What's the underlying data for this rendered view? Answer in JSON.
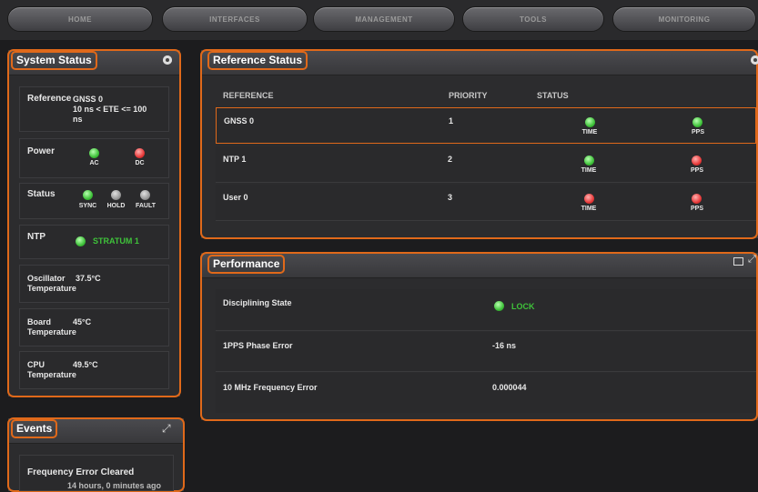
{
  "nav": [
    "HOME",
    "INTERFACES",
    "MANAGEMENT",
    "TOOLS",
    "MONITORING"
  ],
  "system_status": {
    "title": "System Status",
    "reference": {
      "label": "Reference",
      "value_line1": "GNSS 0",
      "value_line2": "10 ns < ETE <= 100",
      "value_line3": "ns"
    },
    "power": {
      "label": "Power",
      "ac": "AC",
      "dc": "DC"
    },
    "status": {
      "label": "Status",
      "sync": "SYNC",
      "hold": "HOLD",
      "fault": "FAULT"
    },
    "ntp": {
      "label": "NTP",
      "value": "STRATUM 1"
    },
    "oscillator": {
      "label_line1": "Oscillator",
      "label_line2": "Temperature",
      "value": "37.5°C"
    },
    "board": {
      "label_line1": "Board",
      "label_line2": "Temperature",
      "value": "45°C"
    },
    "cpu": {
      "label_line1": "CPU",
      "label_line2": "Temperature",
      "value": "49.5°C"
    }
  },
  "events": {
    "title": "Events",
    "item": "Frequency Error Cleared",
    "item_sub": "14 hours, 0 minutes ago"
  },
  "reference_status": {
    "title": "Reference Status",
    "headers": {
      "reference": "REFERENCE",
      "priority": "PRIORITY",
      "status": "STATUS"
    },
    "rows": [
      {
        "name": "GNSS 0",
        "priority": "1",
        "time": "TIME",
        "pps": "PPS",
        "time_color": "green",
        "pps_color": "green"
      },
      {
        "name": "NTP 1",
        "priority": "2",
        "time": "TIME",
        "pps": "PPS",
        "time_color": "green",
        "pps_color": "red"
      },
      {
        "name": "User 0",
        "priority": "3",
        "time": "TIME",
        "pps": "PPS",
        "time_color": "red",
        "pps_color": "red"
      }
    ]
  },
  "performance": {
    "title": "Performance",
    "rows": [
      {
        "label": "Disciplining State",
        "value": "LOCK"
      },
      {
        "label": "1PPS Phase Error",
        "value": "-16 ns"
      },
      {
        "label": "10 MHz Frequency Error",
        "value": "0.000044"
      }
    ]
  },
  "colors": {
    "accent": "#e0691a",
    "ok": "#3fc23a",
    "error": "#e83a3a"
  }
}
